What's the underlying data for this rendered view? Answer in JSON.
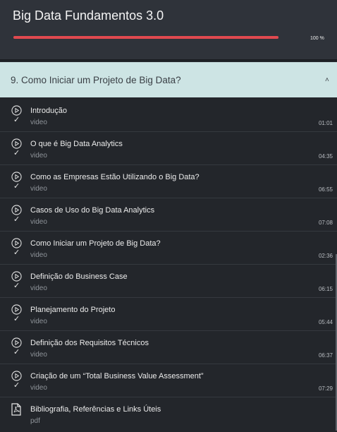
{
  "course": {
    "title": "Big Data Fundamentos 3.0",
    "progress_label": "100 %",
    "progress": 1.0,
    "accent": "#e0494f"
  },
  "section": {
    "title": "9. Como Iniciar um Projeto de Big Data?",
    "chevron": "˄"
  },
  "lessons": [
    {
      "title": "Introdução",
      "type": "video",
      "duration": "01:01",
      "icon": "play-circle-icon"
    },
    {
      "title": "O que é Big Data Analytics",
      "type": "video",
      "duration": "04:35",
      "icon": "play-circle-icon"
    },
    {
      "title": "Como as Empresas Estão Utilizando o Big Data?",
      "type": "video",
      "duration": "06:55",
      "icon": "play-circle-icon"
    },
    {
      "title": "Casos de Uso do Big Data Analytics",
      "type": "video",
      "duration": "07:08",
      "icon": "play-circle-icon"
    },
    {
      "title": "Como Iniciar um Projeto de Big Data?",
      "type": "video",
      "duration": "02:36",
      "icon": "play-circle-icon"
    },
    {
      "title": "Definição do Business Case",
      "type": "video",
      "duration": "06:15",
      "icon": "play-circle-icon"
    },
    {
      "title": "Planejamento do Projeto",
      "type": "video",
      "duration": "05:44",
      "icon": "play-circle-icon"
    },
    {
      "title": "Definição dos Requisitos Técnicos",
      "type": "video",
      "duration": "06:37",
      "icon": "play-circle-icon"
    },
    {
      "title": "Criação de um “Total Business Value Assessment”",
      "type": "video",
      "duration": "07:29",
      "icon": "play-circle-icon"
    },
    {
      "title": "Bibliografia, Referências e Links Úteis",
      "type": "pdf",
      "duration": "",
      "icon": "pdf-file-icon"
    }
  ]
}
